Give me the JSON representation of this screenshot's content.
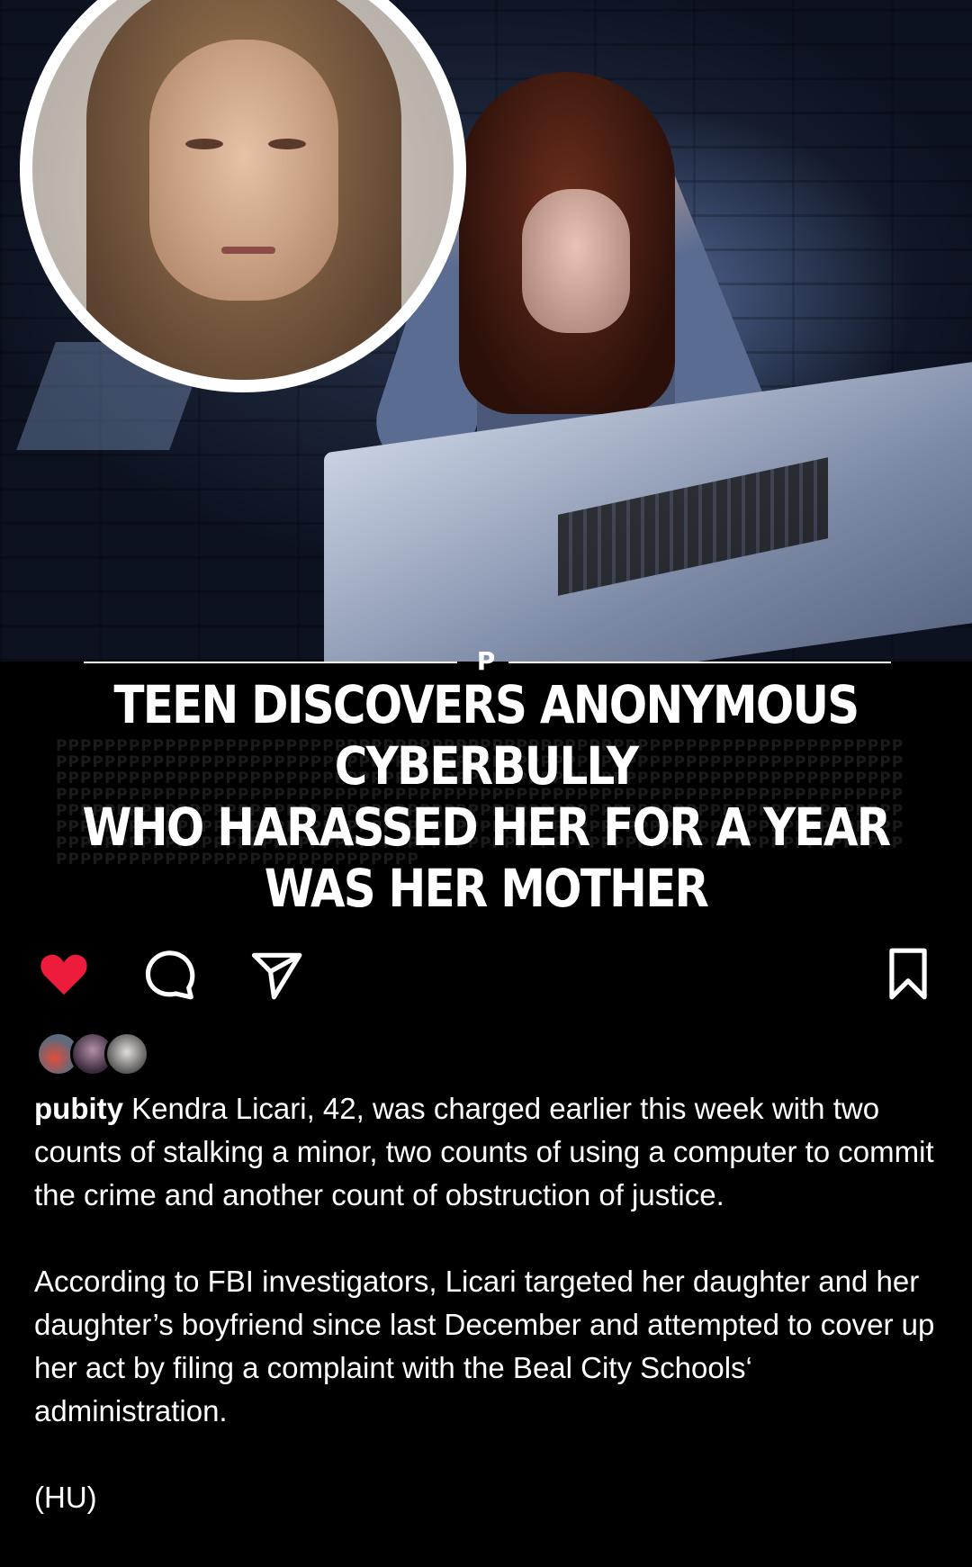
{
  "post": {
    "brand_mark": "P",
    "headline_lines": [
      "TEEN DISCOVERS ANONYMOUS CYBERBULLY",
      "WHO HARASSED HER FOR A YEAR",
      "WAS HER MOTHER"
    ]
  },
  "actions": {
    "icons": [
      "heart-icon",
      "comment-icon",
      "share-icon",
      "bookmark-icon"
    ],
    "like_color": "#ed1c3c"
  },
  "caption": {
    "username": "pubity",
    "paragraph_1": "Kendra Licari, 42, was charged earlier this week with two counts of stalking a minor, two counts of using a computer to commit the crime and another count of obstruction of justice.",
    "paragraph_2": "According to FBI investigators, Licari targeted her daughter and her daughter’s boyfriend since last December and attempted to cover up her act by filing a complaint with the Beal City Schools‘ administration.",
    "paragraph_3": "(HU)"
  }
}
